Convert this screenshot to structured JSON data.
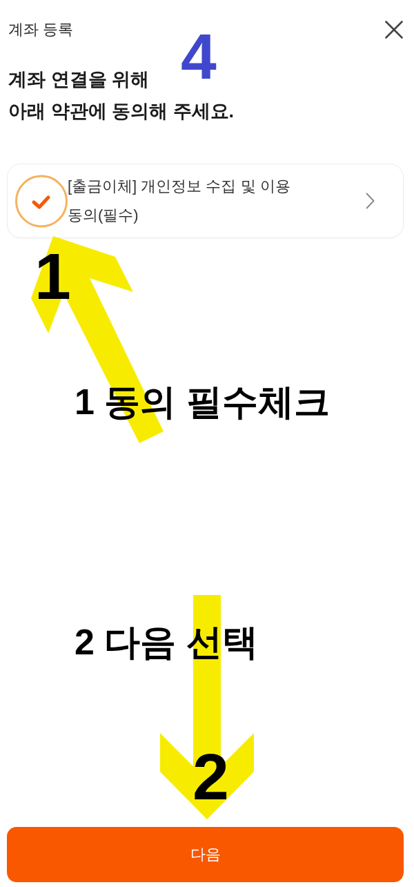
{
  "header": {
    "title": "계좌 등록"
  },
  "heading": {
    "lines": [
      "계좌 연결을 위해",
      "아래 약관에 동의해 주세요."
    ]
  },
  "agreements": [
    {
      "label": "[출금이체] 개인정보 수집 및 이용 동의(필수)",
      "checked": true
    }
  ],
  "next_button": {
    "label": "다음"
  },
  "annotations": {
    "page_number": "4",
    "steps": [
      {
        "number": "1",
        "caption": "1 동의 필수체크"
      },
      {
        "number": "2",
        "caption": "2 다음 선택"
      }
    ]
  }
}
